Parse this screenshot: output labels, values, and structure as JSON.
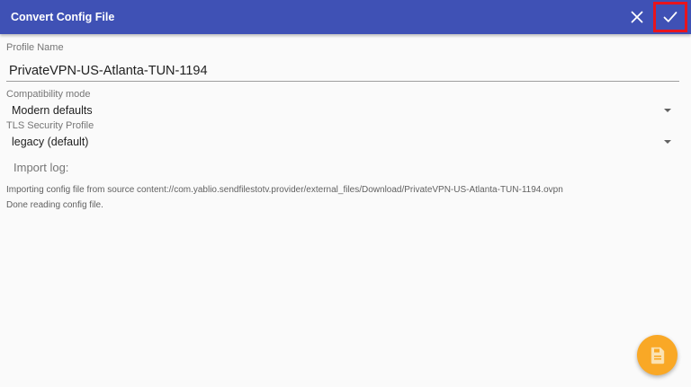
{
  "toolbar": {
    "title": "Convert Config File",
    "close_icon": "close-icon",
    "confirm_icon": "check-icon",
    "background_color": "#3f51b5",
    "confirm_highlight_color": "#e8141d"
  },
  "profile": {
    "label": "Profile Name",
    "value": "PrivateVPN-US-Atlanta-TUN-1194"
  },
  "compatibility": {
    "label": "Compatibility mode",
    "selected": "Modern defaults"
  },
  "tls": {
    "label": "TLS Security Profile",
    "selected": "legacy (default)"
  },
  "import_log": {
    "title": "Import log:",
    "lines": [
      "Importing config file from source content://com.yablio.sendfilestotv.provider/external_files/Download/PrivateVPN-US-Atlanta-TUN-1194.ovpn",
      "Done reading config file."
    ]
  },
  "fab": {
    "icon": "save-icon",
    "color": "#f9a826"
  }
}
